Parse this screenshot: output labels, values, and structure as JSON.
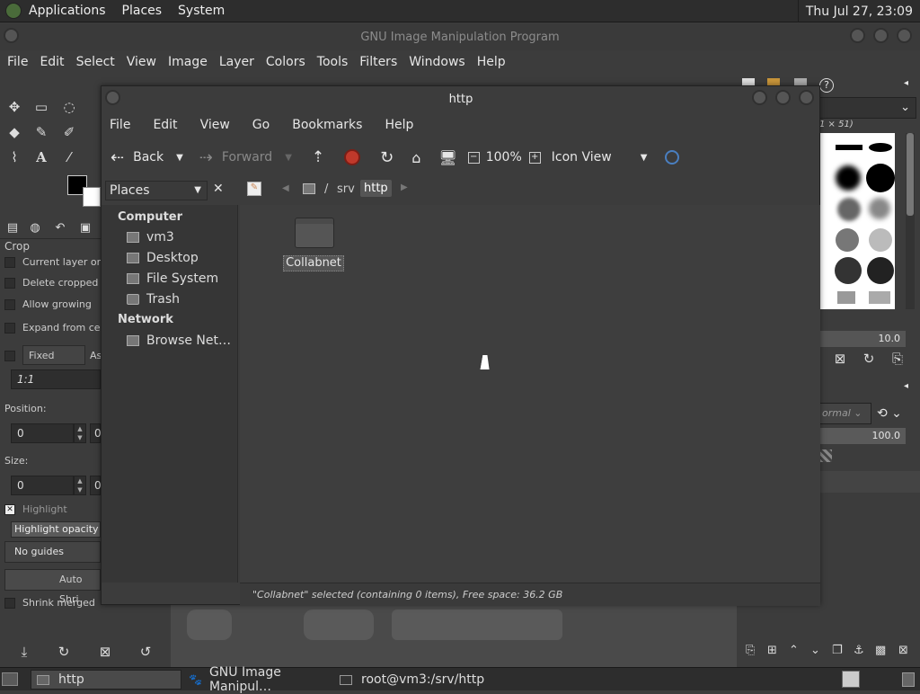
{
  "top_panel": {
    "menus": [
      "Applications",
      "Places",
      "System"
    ],
    "clock": "Thu Jul 27, 23:09"
  },
  "gimp": {
    "title": "GNU Image Manipulation Program",
    "menu": [
      "File",
      "Edit",
      "Select",
      "View",
      "Image",
      "Layer",
      "Colors",
      "Tools",
      "Filters",
      "Windows",
      "Help"
    ],
    "tool_options": {
      "title": "Crop",
      "current_layer_only": "Current layer only",
      "delete_cropped": "Delete cropped pi",
      "allow_growing": "Allow growing",
      "expand_from_center": "Expand from cent",
      "fixed": "Fixed",
      "fixed_suffix": "As",
      "ratio": "1:1",
      "position_label": "Position:",
      "position_x": "0",
      "position_y_partial": "0",
      "size_label": "Size:",
      "size_x": "0",
      "size_y_partial": "0",
      "highlight": "Highlight",
      "highlight_opacity": "Highlight opacity",
      "guides": "No guides",
      "auto_shrink": "Auto Shri",
      "shrink_merged": "Shrink merged"
    },
    "brushes": {
      "size_label": "1 × 51)",
      "spacing": "10.0"
    },
    "layers": {
      "mode": "ormal",
      "opacity": "100.0"
    }
  },
  "file_manager": {
    "title": "http",
    "menu": [
      "File",
      "Edit",
      "View",
      "Go",
      "Bookmarks",
      "Help"
    ],
    "toolbar": {
      "back": "Back",
      "forward": "Forward",
      "zoom": "100%",
      "view_mode": "Icon View"
    },
    "places_combo": "Places",
    "path": {
      "root": "/",
      "segments": [
        "srv",
        "http"
      ]
    },
    "sidebar": {
      "computer_heading": "Computer",
      "computer_items": [
        "vm3",
        "Desktop",
        "File System",
        "Trash"
      ],
      "network_heading": "Network",
      "network_items": [
        "Browse Net…"
      ]
    },
    "files": [
      {
        "name": "Collabnet",
        "type": "folder",
        "selected": true
      }
    ],
    "status": "\"Collabnet\" selected (containing 0 items), Free space: 36.2 GB"
  },
  "taskbar": {
    "tasks": [
      "http",
      "GNU Image Manipul…",
      "root@vm3:/srv/http"
    ]
  },
  "colors": {
    "panel": "#2d2d2d",
    "window": "#3c3c3c",
    "accent_stop": "#c0392b",
    "folder": "#5a5a5a"
  }
}
